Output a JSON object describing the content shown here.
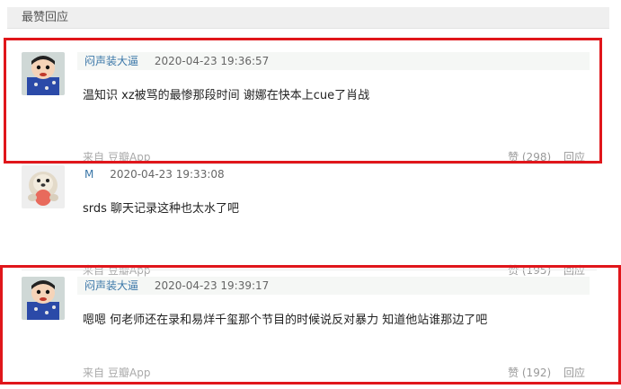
{
  "header": {
    "title": "最赞回应"
  },
  "comments": [
    {
      "user": "闷声装大逼",
      "time": "2020-04-23 19:36:57",
      "text": "温知识 xz被骂的最惨那段时间 谢娜在快本上cue了肖战",
      "source_prefix": "来自",
      "source_app": "豆瓣App",
      "likes": "赞 (298)",
      "reply": "回应",
      "avatar_icon": "crayon-shin-chan-avatar-icon"
    },
    {
      "user": "M",
      "time": "2020-04-23 19:33:08",
      "text": "srds 聊天记录这种也太水了吧",
      "source_prefix": "来自",
      "source_app": "豆瓣App",
      "likes": "赞 (195)",
      "reply": "回应",
      "avatar_icon": "otter-avatar-icon"
    },
    {
      "user": "闷声装大逼",
      "time": "2020-04-23 19:39:17",
      "text": "嗯嗯 何老师还在录和易烊千玺那个节目的时候说反对暴力 知道他站谁那边了吧",
      "source_prefix": "来自",
      "source_app": "豆瓣App",
      "likes": "赞 (192)",
      "reply": "回应",
      "avatar_icon": "crayon-shin-chan-avatar-icon"
    }
  ],
  "colors": {
    "highlight_border": "#e0161b",
    "username": "#3b77a8",
    "meta_bg": "#f5f7f5"
  }
}
